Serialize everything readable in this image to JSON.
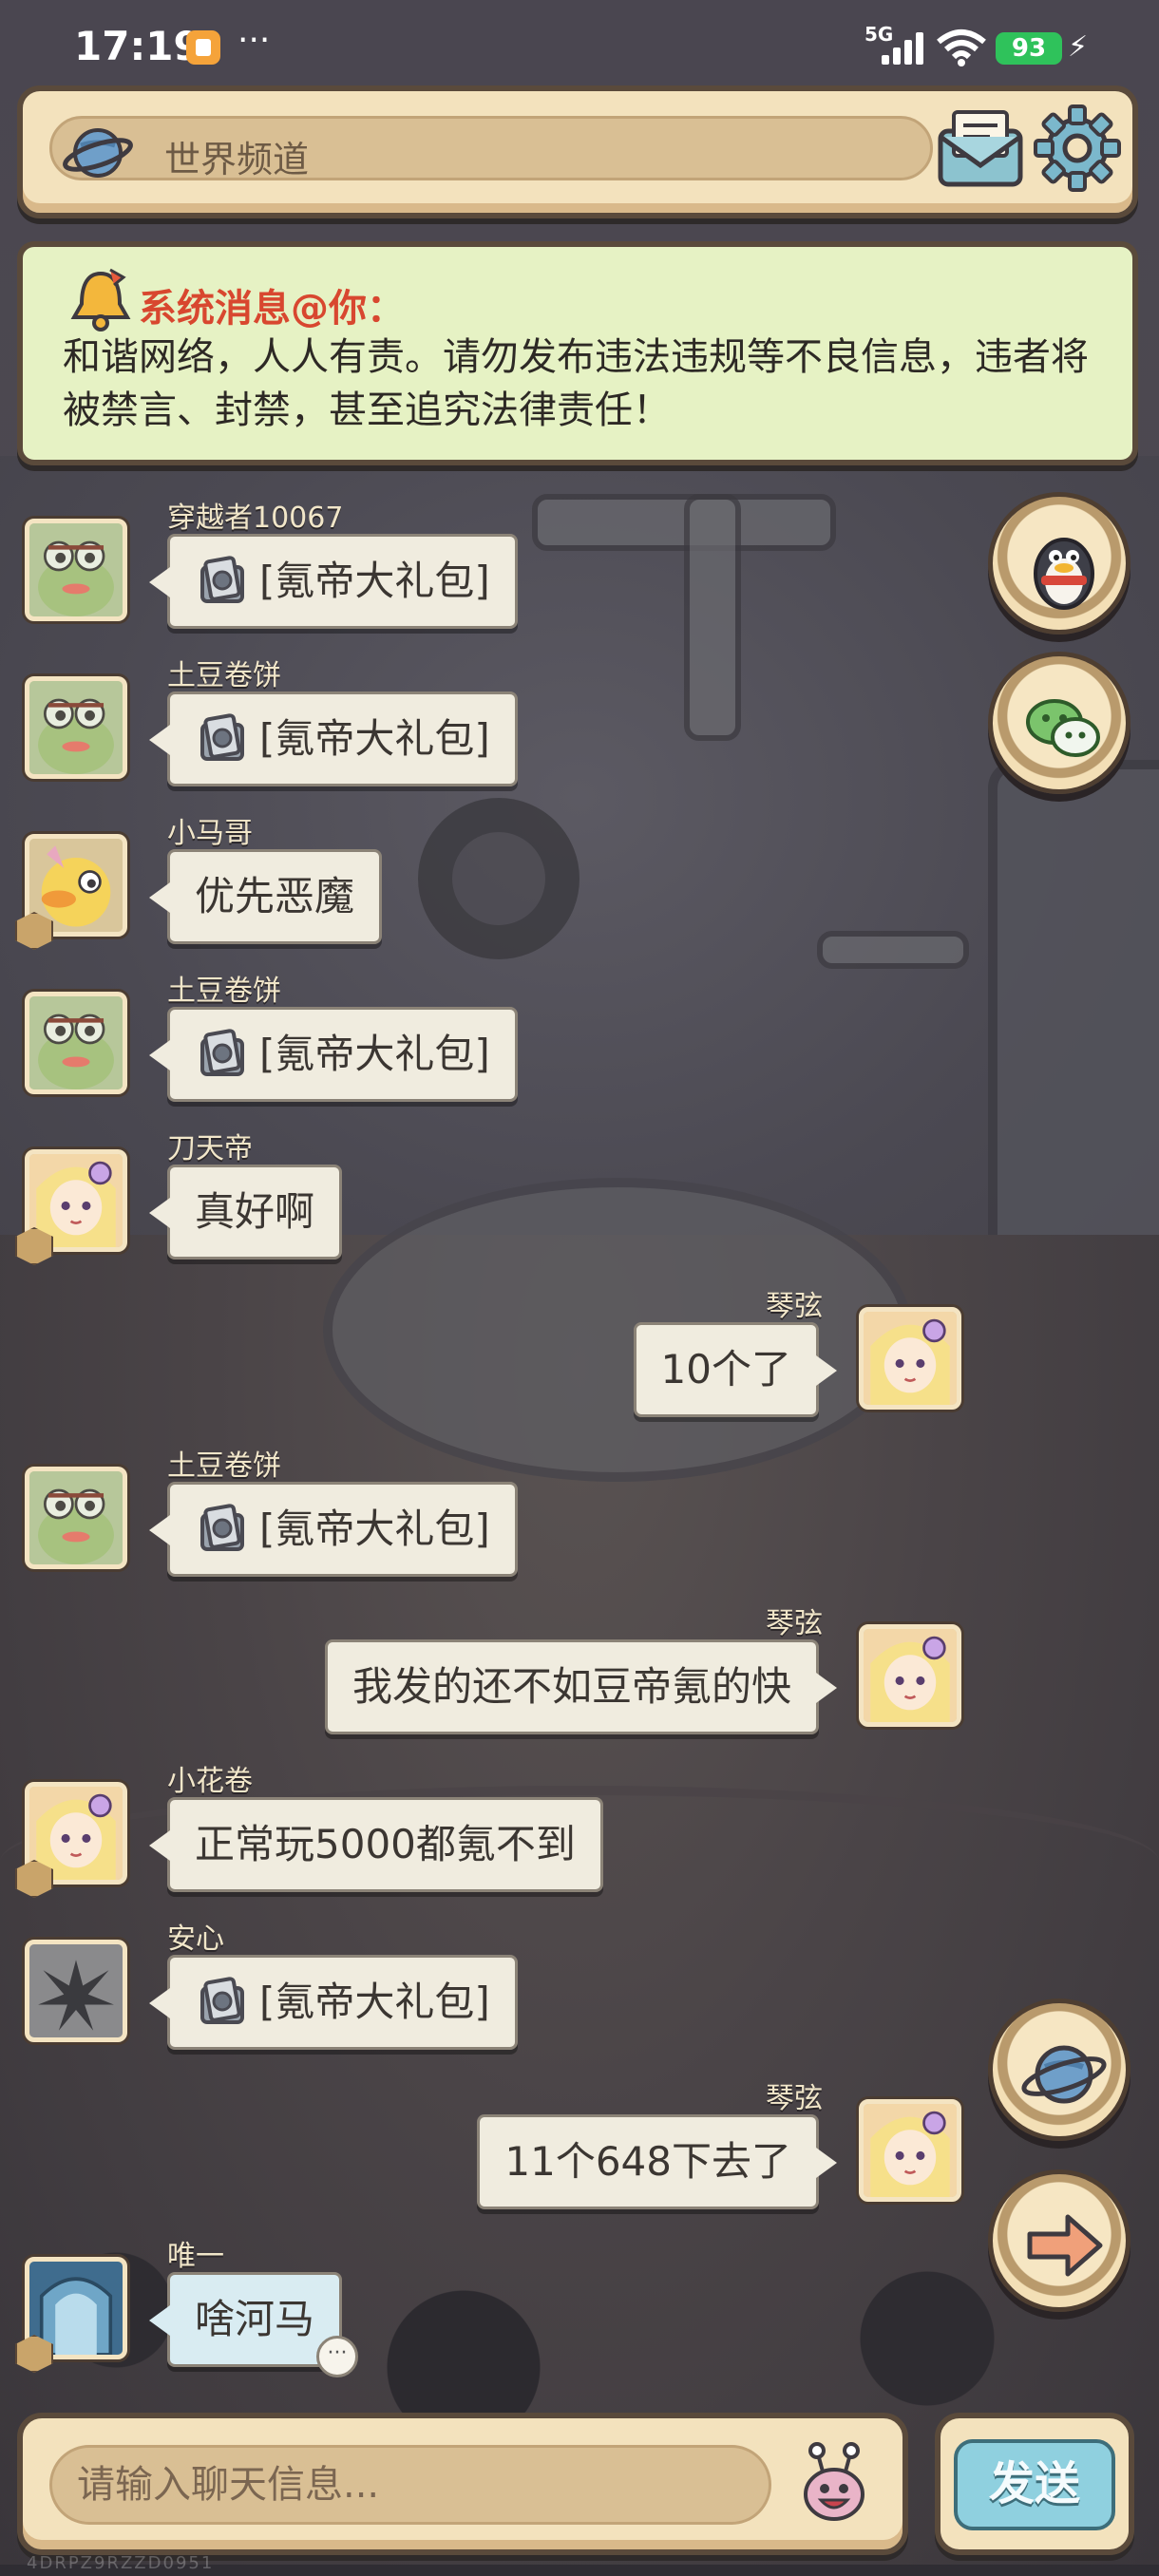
{
  "status_bar": {
    "time": "17:19",
    "network": "5G",
    "battery": "93"
  },
  "header": {
    "channel_label": "世界频道"
  },
  "system_message": {
    "title": "系统消息@你：",
    "body": "和谐网络，人人有责。请勿发布违法违规等不良信息，违者将被禁言、封禁，甚至追究法律责任！"
  },
  "messages": [
    {
      "side": "left",
      "name": "穿越者10067",
      "text": "[氪帝大礼包]",
      "gift": true,
      "avatar": "frog"
    },
    {
      "side": "left",
      "name": "土豆卷饼",
      "text": "[氪帝大礼包]",
      "gift": true,
      "avatar": "frog"
    },
    {
      "side": "left",
      "name": "小马哥",
      "text": "优先恶魔",
      "gift": false,
      "avatar": "duck"
    },
    {
      "side": "left",
      "name": "土豆卷饼",
      "text": "[氪帝大礼包]",
      "gift": true,
      "avatar": "frog"
    },
    {
      "side": "left",
      "name": "刀天帝",
      "text": "真好啊",
      "gift": false,
      "avatar": "girl"
    },
    {
      "side": "right",
      "name": "琴弦",
      "text": "10个了",
      "gift": false,
      "avatar": "girl"
    },
    {
      "side": "left",
      "name": "土豆卷饼",
      "text": "[氪帝大礼包]",
      "gift": true,
      "avatar": "frog"
    },
    {
      "side": "right",
      "name": "琴弦",
      "text": "我发的还不如豆帝氪的快",
      "gift": false,
      "avatar": "girl"
    },
    {
      "side": "left",
      "name": "小花卷",
      "text": "正常玩5000都氪不到",
      "gift": false,
      "avatar": "girl"
    },
    {
      "side": "left",
      "name": "安心",
      "text": "[氪帝大礼包]",
      "gift": true,
      "avatar": "shadow"
    },
    {
      "side": "right",
      "name": "琴弦",
      "text": "11个648下去了",
      "gift": false,
      "avatar": "girl"
    },
    {
      "side": "left",
      "name": "唯一",
      "text": "啥河马",
      "gift": false,
      "avatar": "gate"
    }
  ],
  "input": {
    "placeholder": "请输入聊天信息...",
    "send_label": "发送"
  },
  "watermark": "4DRPZ9RZZD0951",
  "colors": {
    "system_title": "#d8472f",
    "panel": "#f3e2bd",
    "bubble": "#f0ecdf",
    "send_button": "#8fd0df",
    "battery": "#2fc25b"
  },
  "icons": [
    "planet-icon",
    "mail-icon",
    "gear-icon",
    "bell-icon",
    "penguin-icon",
    "wechat-icon",
    "globe-icon",
    "arrow-right-icon",
    "emoji-icon",
    "gift-pack-icon"
  ]
}
